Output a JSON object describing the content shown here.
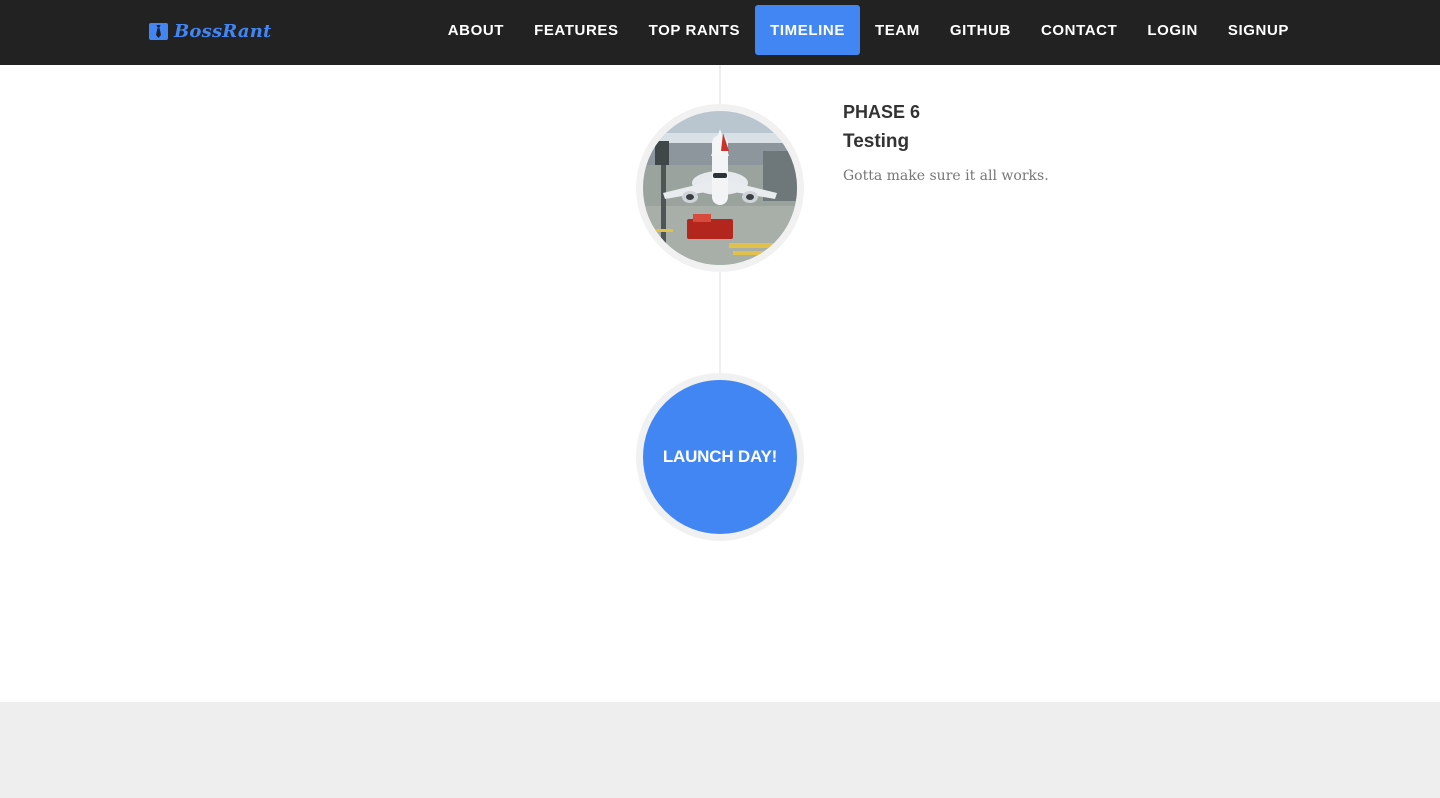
{
  "brand": {
    "name": "BossRant",
    "icon": "necktie-icon",
    "color": "#4286f4"
  },
  "nav": {
    "items": [
      {
        "label": "About",
        "active": false
      },
      {
        "label": "Features",
        "active": false
      },
      {
        "label": "Top Rants",
        "active": false
      },
      {
        "label": "Timeline",
        "active": true
      },
      {
        "label": "Team",
        "active": false
      },
      {
        "label": "Github",
        "active": false
      },
      {
        "label": "Contact",
        "active": false
      },
      {
        "label": "Login",
        "active": false
      },
      {
        "label": "Signup",
        "active": false
      }
    ],
    "active_color": "#4286f4",
    "background": "#222222"
  },
  "timeline": {
    "entry": {
      "phase": "Phase 6",
      "title": "Testing",
      "body": "Gotta make sure it all works.",
      "image": "airplane-at-gate-photo"
    },
    "final": {
      "label": "Launch Day!"
    }
  },
  "colors": {
    "accent": "#4286f4",
    "footer_background": "#eeeeee"
  }
}
